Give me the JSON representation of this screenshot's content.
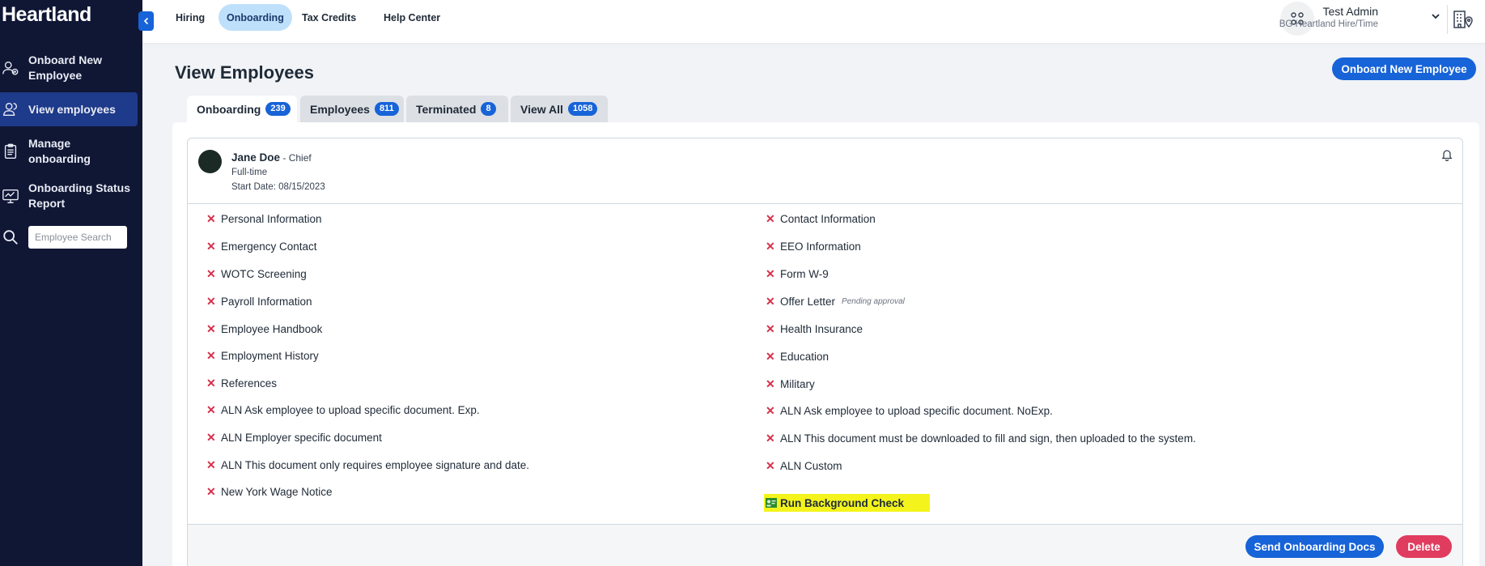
{
  "sidebar": {
    "brand": "Heartland",
    "items": [
      {
        "label_line1": "Onboard New",
        "label_line2": "Employee",
        "icon": "user-add-icon"
      },
      {
        "label_line1": "View employees",
        "label_line2": "",
        "icon": "users-icon"
      },
      {
        "label_line1": "Manage",
        "label_line2": "onboarding",
        "icon": "clipboard-icon"
      },
      {
        "label_line1": "Onboarding Status",
        "label_line2": "Report",
        "icon": "chart-icon"
      }
    ],
    "search_placeholder": "Employee Search"
  },
  "topbar": {
    "links": [
      "Hiring",
      "Onboarding",
      "Tax Credits",
      "Help Center"
    ],
    "active_link": "Onboarding",
    "user_name": "Test Admin",
    "user_company": "BG Heartland Hire/Time"
  },
  "main": {
    "title": "View Employees",
    "primary_action": "Onboard New Employee",
    "tabs": [
      {
        "label": "Onboarding",
        "count": "239"
      },
      {
        "label": "Employees",
        "count": "811"
      },
      {
        "label": "Terminated",
        "count": "8"
      },
      {
        "label": "View All",
        "count": "1058"
      }
    ]
  },
  "employee": {
    "name": "Jane Doe",
    "title_sep": " - Chief",
    "type": "Full-time",
    "start_date": "Start Date: 08/15/2023"
  },
  "tasks_left": [
    "Personal Information",
    "Emergency Contact",
    "WOTC Screening",
    "Payroll Information",
    "Employee Handbook",
    "Employment History",
    "References",
    "ALN Ask employee to upload specific document. Exp.",
    "ALN Employer specific document",
    "ALN This document only requires employee signature and date.",
    "New York Wage Notice"
  ],
  "tasks_right": [
    "Contact Information",
    "EEO Information",
    "Form W-9",
    "Offer Letter",
    "Health Insurance",
    "Education",
    "Military",
    "ALN Ask employee to upload specific document. NoExp.",
    "ALN This document must be downloaded to fill and sign, then uploaded to the system.",
    "ALN Custom"
  ],
  "offer_letter_status": "Pending approval",
  "highlight_task": "Run Background Check",
  "status_mark": "✕",
  "footer": {
    "send_label": "Send Onboarding Docs",
    "delete_label": "Delete"
  },
  "colors": {
    "sidebar_bg": "#101735",
    "accent": "#1763d8",
    "danger": "#e03c5f",
    "highlight": "#f4f41c"
  }
}
